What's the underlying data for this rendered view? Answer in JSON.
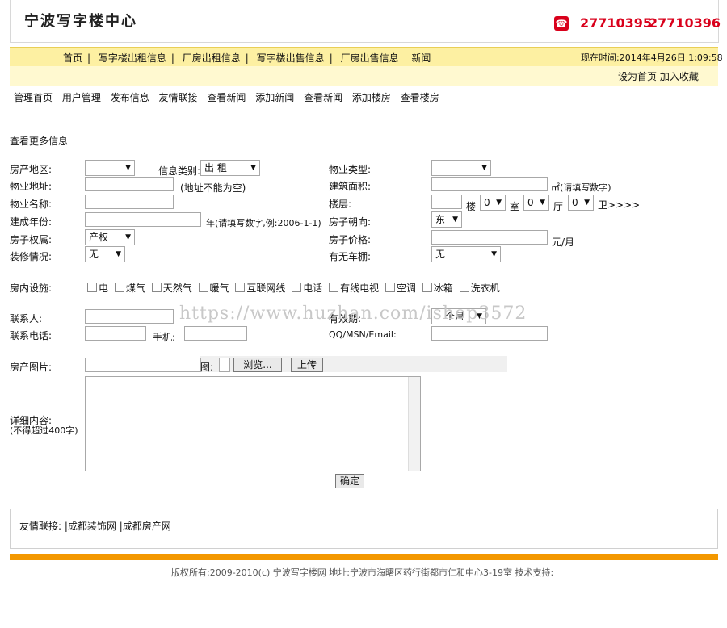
{
  "header": {
    "title": "宁波写字楼中心",
    "phone1": "27710395",
    "phone2": "27710396"
  },
  "nav": {
    "items": [
      "首页",
      "写字楼出租信息",
      "厂房出租信息",
      "写字楼出售信息",
      "厂房出售信息",
      "新闻"
    ],
    "time": "现在时间:2014年4月26日 1:09:58",
    "sethome": "设为首页",
    "favorite": "加入收藏"
  },
  "admin_menu": [
    "管理首页",
    "用户管理",
    "发布信息",
    "友情联接",
    "查看新闻",
    "添加新闻",
    "查看新闻",
    "添加楼房",
    "查看楼房"
  ],
  "form": {
    "heading": "查看更多信息",
    "region_label": "房产地区:",
    "info_type_label": "信息类别:",
    "info_type_value": "出 租",
    "property_type_label": "物业类型:",
    "address_label": "物业地址:",
    "address_hint": "(地址不能为空)",
    "area_label": "建筑面积:",
    "area_hint": "㎡(请填写数字)",
    "name_label": "物业名称:",
    "floor_label": "楼层:",
    "floor_unit": "楼",
    "room_value": "0",
    "room_unit": "室",
    "hall_value": "0",
    "hall_unit": "厅",
    "bath_value": "0",
    "bath_unit": "卫>>>>",
    "year_label": "建成年份:",
    "year_hint": "年(请填写数字,例:2006-1-1)",
    "orient_label": "房子朝向:",
    "orient_value": "东",
    "ownership_label": "房子权属:",
    "ownership_value": "产权",
    "price_label": "房子价格:",
    "price_unit": "元/月",
    "decor_label": "装修情况:",
    "decor_value": "无",
    "garage_label": "有无车棚:",
    "garage_value": "无",
    "facilities_label": "房内设施:",
    "facilities": [
      "电",
      "煤气",
      "天然气",
      "暖气",
      "互联网线",
      "电话",
      "有线电视",
      "空调",
      "冰箱",
      "洗衣机"
    ],
    "contact_label": "联系人:",
    "validity_label": "有效期:",
    "validity_value": "一个月",
    "phone_label": "联系电话:",
    "mobile_label": "手机:",
    "qq_label": "QQ/MSN/Email:",
    "photo_label": "房产图片:",
    "photo_tu": "图:",
    "browse": "浏览...",
    "upload": "上传",
    "detail_label": "详细内容:",
    "detail_hint": "(不得超过400字)",
    "submit": "确定"
  },
  "watermark": "https://www.huzhan.com/ishop3572",
  "links": {
    "label": "友情联接:",
    "items": [
      "|成都装饰网",
      "|成都房产网"
    ]
  },
  "footer": "版权所有:2009-2010(c) 宁波写字楼网 地址:宁波市海曙区药行街都市仁和中心3-19室 技术支持:"
}
